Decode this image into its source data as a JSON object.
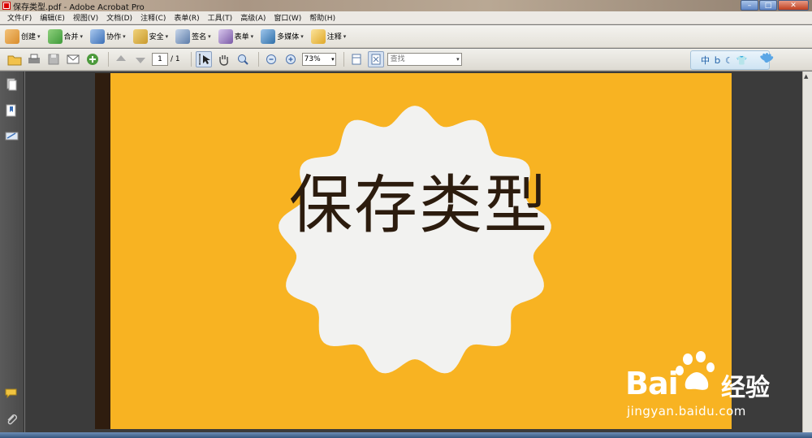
{
  "window": {
    "title": "保存类型.pdf - Adobe Acrobat Pro"
  },
  "menu": [
    "文件(F)",
    "编辑(E)",
    "视图(V)",
    "文档(D)",
    "注释(C)",
    "表单(R)",
    "工具(T)",
    "高级(A)",
    "窗口(W)",
    "帮助(H)"
  ],
  "tasks": [
    {
      "label": "创建",
      "icon": "create-icon",
      "color": "#d98c2b"
    },
    {
      "label": "合并",
      "icon": "combine-icon",
      "color": "#3f9a3a"
    },
    {
      "label": "协作",
      "icon": "collaborate-icon",
      "color": "#3b6fb6"
    },
    {
      "label": "安全",
      "icon": "lock-icon",
      "color": "#c99a2e"
    },
    {
      "label": "签名",
      "icon": "pen-icon",
      "color": "#5b7ba8"
    },
    {
      "label": "表单",
      "icon": "form-icon",
      "color": "#7a5aa6"
    },
    {
      "label": "多媒体",
      "icon": "multimedia-icon",
      "color": "#2f6fa8"
    },
    {
      "label": "注释",
      "icon": "comment-icon",
      "color": "#e0a828"
    }
  ],
  "toolbar": {
    "page_current": "1",
    "page_total": "/ 1",
    "zoom": "73%",
    "find_placeholder": "查找"
  },
  "ime": {
    "lang": "中",
    "icons": [
      "punctuation-icon",
      "moon-icon",
      "shirt-icon",
      "lotus-icon"
    ]
  },
  "document": {
    "heading": "保存类型",
    "colors": {
      "background": "#f8b322",
      "seal": "#f2f2f0",
      "text": "#2c1c0e",
      "strip": "#2f1d0f"
    }
  },
  "watermark": {
    "brand": "Bai",
    "brand_suffix": "经验",
    "url": "jingyan.baidu.com"
  }
}
